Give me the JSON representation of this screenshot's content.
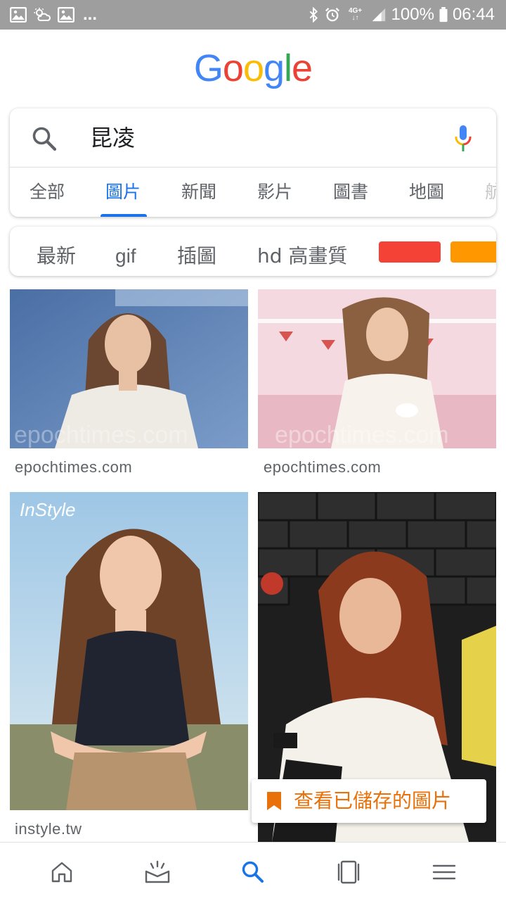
{
  "status_bar": {
    "dots": "...",
    "network": "4G+",
    "battery": "100%",
    "time": "06:44",
    "left_icons": [
      "image-icon",
      "weather-icon",
      "image-icon"
    ],
    "right_icons": [
      "bluetooth-icon",
      "alarm-icon",
      "signal-icon",
      "battery-icon"
    ]
  },
  "logo": "Google",
  "search": {
    "query": "昆凌"
  },
  "tabs": [
    {
      "label": "全部",
      "active": false
    },
    {
      "label": "圖片",
      "active": true
    },
    {
      "label": "新聞",
      "active": false
    },
    {
      "label": "影片",
      "active": false
    },
    {
      "label": "圖書",
      "active": false
    },
    {
      "label": "地圖",
      "active": false
    },
    {
      "label": "航",
      "active": false
    }
  ],
  "chips": {
    "items": [
      "最新",
      "gif",
      "插圖",
      "hd 高畫質"
    ],
    "colors": [
      "#f44336",
      "#ff9800"
    ]
  },
  "results": [
    {
      "source": "epochtimes.com"
    },
    {
      "source": "epochtimes.com"
    },
    {
      "source": "instyle.tw"
    },
    {
      "source": ""
    }
  ],
  "saved": {
    "label": "查看已儲存的圖片",
    "accent": "#e8710a"
  },
  "bottom_nav": [
    {
      "icon": "home-icon"
    },
    {
      "icon": "updates-icon"
    },
    {
      "icon": "search-icon",
      "active": true
    },
    {
      "icon": "tabs-icon"
    },
    {
      "icon": "menu-icon"
    }
  ],
  "colors": {
    "accent": "#1a73e8",
    "status_bar": "#9e9e9e"
  }
}
